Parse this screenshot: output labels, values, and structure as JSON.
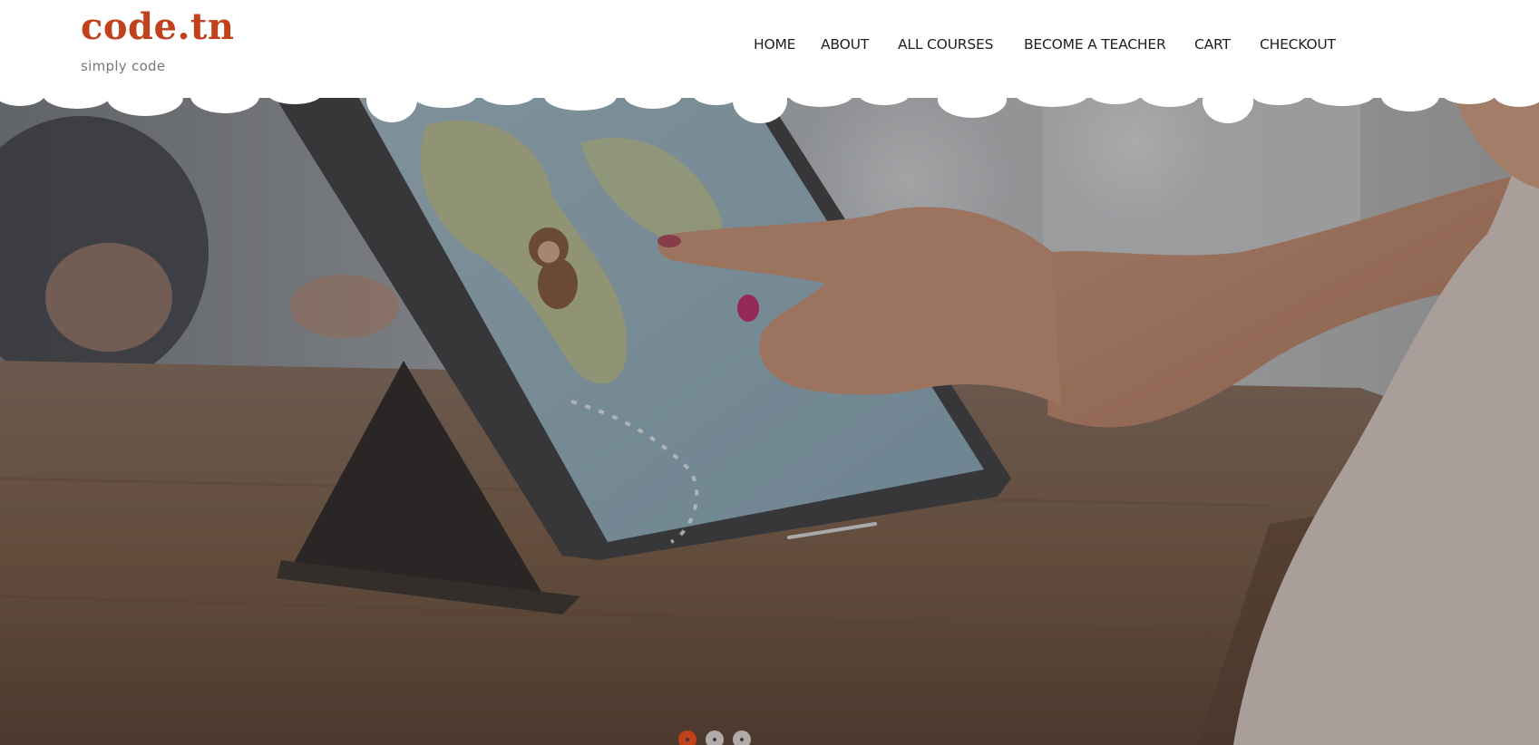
{
  "brand": {
    "name": "code.tn",
    "tagline": "simply code",
    "color": "#c0411b"
  },
  "nav": {
    "items": [
      {
        "label": "HOME"
      },
      {
        "label": "ABOUT"
      },
      {
        "label": "ALL COURSES"
      },
      {
        "label": "BECOME A TEACHER"
      },
      {
        "label": "CART"
      },
      {
        "label": "CHECKOUT"
      }
    ]
  },
  "hero": {
    "image": "child-pointing-at-tablet-with-world-map"
  },
  "carousel": {
    "slide_count": 3,
    "active_index": 0,
    "active_color": "#c0411b"
  }
}
